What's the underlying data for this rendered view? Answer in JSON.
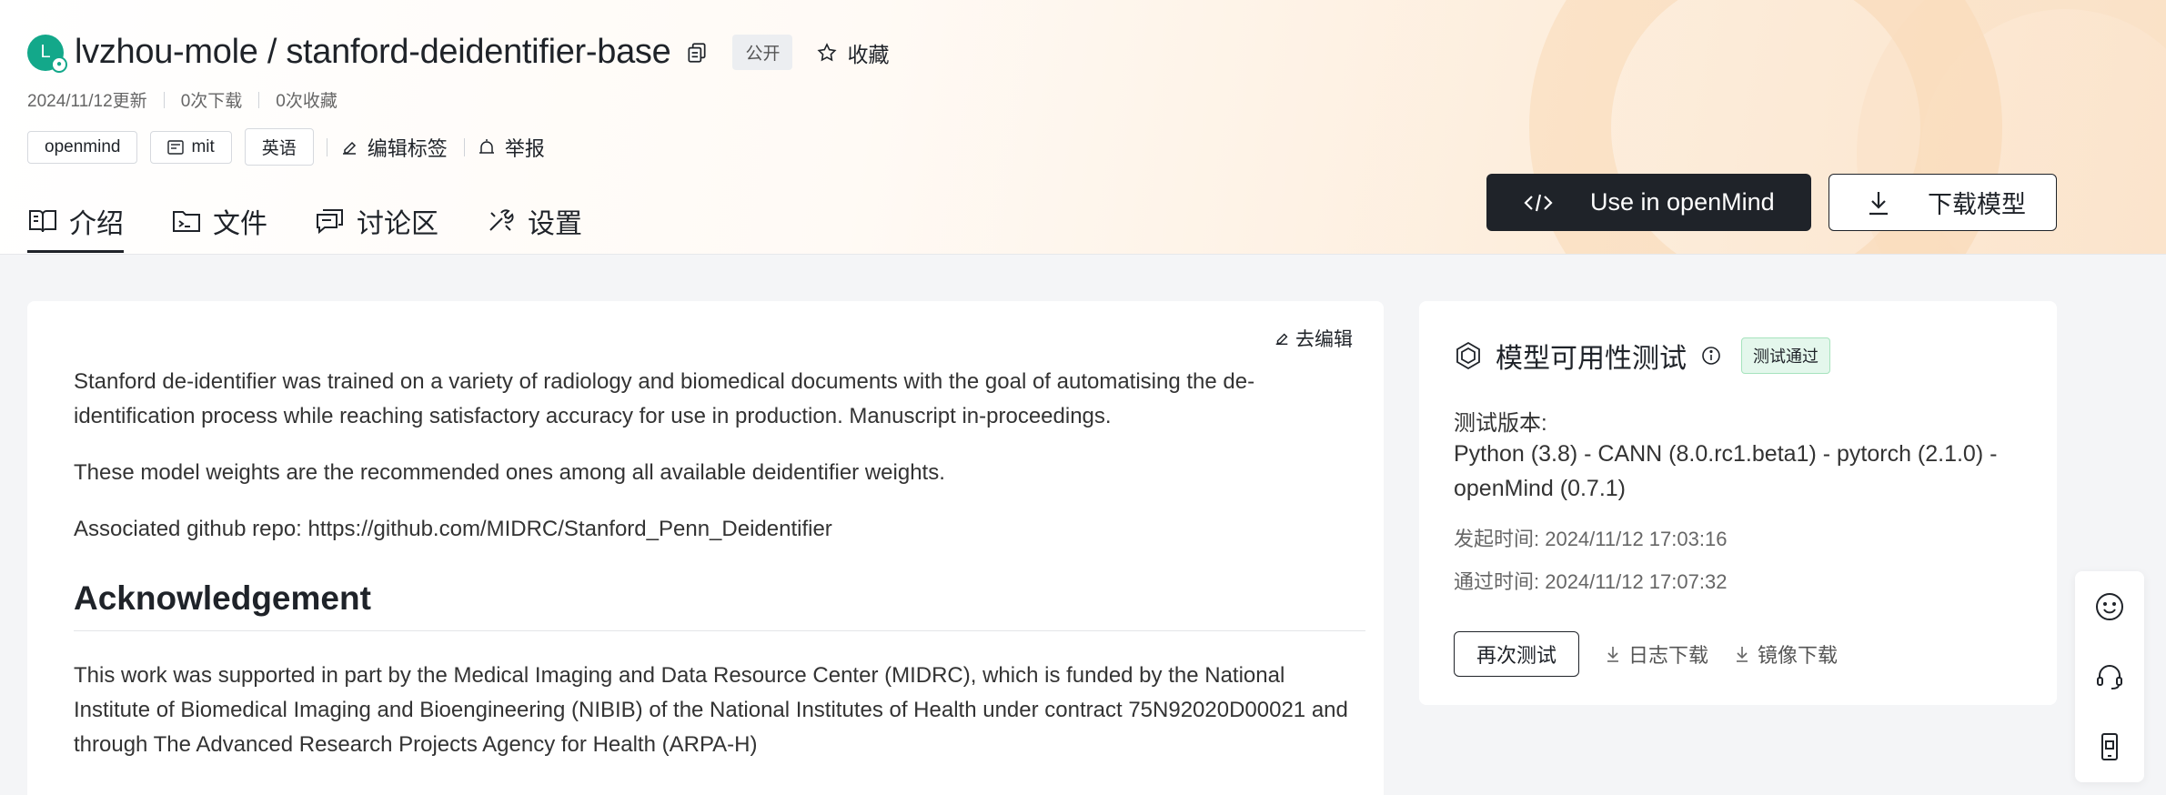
{
  "repo": {
    "avatar_letter": "L",
    "title": "lvzhou-mole / stanford-deidentifier-base",
    "visibility": "公开",
    "favorite_label": "收藏",
    "updated": "2024/11/12更新",
    "downloads": "0次下载",
    "favorites": "0次收藏"
  },
  "tags": {
    "items": [
      "openmind",
      "mit",
      "英语"
    ],
    "edit_label": "编辑标签",
    "report_label": "举报"
  },
  "tabs": [
    {
      "label": "介绍",
      "icon": "book-icon",
      "active": true
    },
    {
      "label": "文件",
      "icon": "folder-icon",
      "active": false
    },
    {
      "label": "讨论区",
      "icon": "discussion-icon",
      "active": false
    },
    {
      "label": "设置",
      "icon": "tools-icon",
      "active": false
    }
  ],
  "actions": {
    "use_openmind": "Use in openMind",
    "download_model": "下载模型"
  },
  "readme": {
    "edit_label": "去编辑",
    "p1": "Stanford de-identifier was trained on a variety of radiology and biomedical documents with the goal of automatising the de-identification process while reaching satisfactory accuracy for use in production. Manuscript in-proceedings.",
    "p2": "These model weights are the recommended ones among all available deidentifier weights.",
    "p3": "Associated github repo: https://github.com/MIDRC/Stanford_Penn_Deidentifier",
    "ack_title": "Acknowledgement",
    "p4": "This work was supported in part by the Medical Imaging and Data Resource Center (MIDRC), which is funded by the National Institute of Biomedical Imaging and Bioengineering (NIBIB) of the National Institutes of Health under contract 75N92020D00021 and through The Advanced Research Projects Agency for Health (ARPA-H)"
  },
  "test": {
    "title": "模型可用性测试",
    "badge": "测试通过",
    "version_label": "测试版本:",
    "version_value": "Python (3.8) - CANN (8.0.rc1.beta1) - pytorch (2.1.0) - openMind (0.7.1)",
    "start_time": "发起时间:  2024/11/12 17:03:16",
    "pass_time": "通过时间:  2024/11/12 17:07:32",
    "retest_label": "再次测试",
    "log_download": "日志下载",
    "mirror_download": "镜像下载"
  },
  "colors": {
    "accent_dark": "#1f2329",
    "avatar": "#13a88a",
    "pass_bg": "#e4f7ec"
  }
}
